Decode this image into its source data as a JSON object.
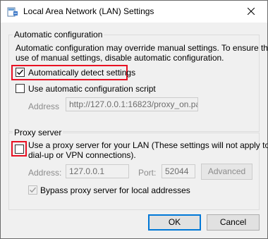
{
  "window": {
    "title": "Local Area Network (LAN) Settings",
    "close_glyph": "✕"
  },
  "auto_config": {
    "heading": "Automatic configuration",
    "description_line1": "Automatic configuration may override manual settings.  To ensure the",
    "description_line2": "use of manual settings, disable automatic configuration.",
    "auto_detect_label": "Automatically detect settings",
    "auto_detect_checked": true,
    "script_label": "Use automatic configuration script",
    "script_checked": false,
    "address_label": "Address",
    "address_value": "http://127.0.0.1:16823/proxy_on.pa"
  },
  "proxy": {
    "heading": "Proxy server",
    "use_proxy_line1": "Use a proxy server for your LAN (These settings will not apply to",
    "use_proxy_line2": "dial-up or VPN connections).",
    "use_proxy_checked": false,
    "address_label": "Address:",
    "address_value": "127.0.0.1",
    "port_label": "Port:",
    "port_value": "52044",
    "advanced_label": "Advanced",
    "bypass_label": "Bypass proxy server for local addresses",
    "bypass_checked": true
  },
  "footer": {
    "ok_label": "OK",
    "cancel_label": "Cancel"
  },
  "colors": {
    "highlight": "#e81123",
    "default_button_border": "#0078d7",
    "disabled_text": "#8c8c8c"
  }
}
